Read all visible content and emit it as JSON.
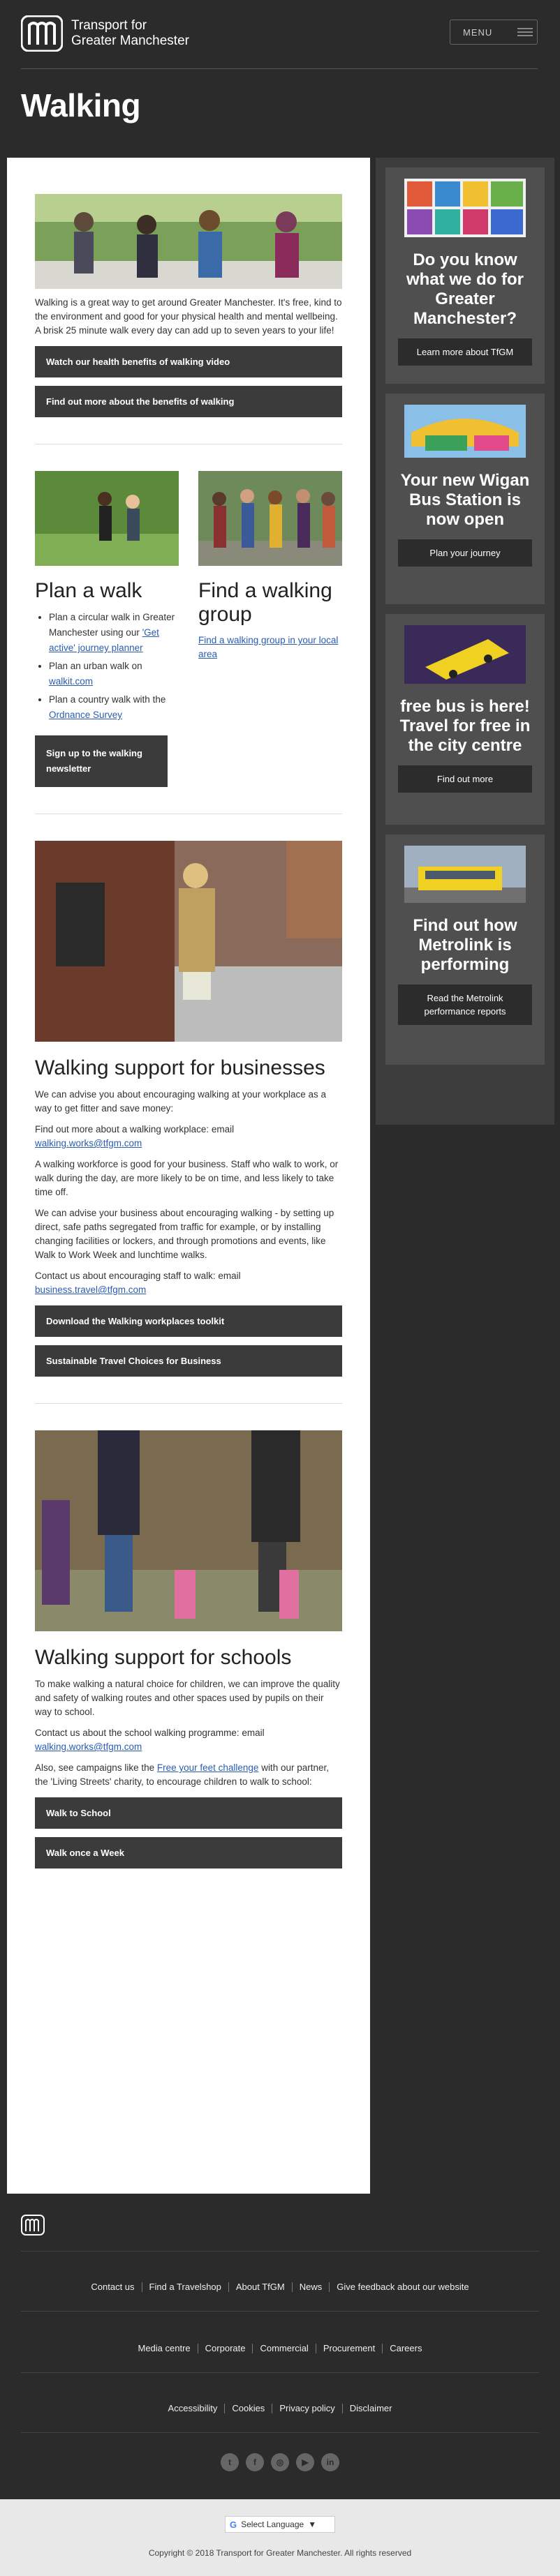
{
  "header": {
    "brand_line1": "Transport for",
    "brand_line2": "Greater Manchester",
    "menu_label": "MENU",
    "page_title": "Walking"
  },
  "intro": {
    "text": "Walking is a great way to get around Greater Manchester. It's free, kind to the environment and good for your physical health and mental wellbeing. A brisk 25 minute walk every day can add up to seven years to your life!",
    "btn_video": "Watch our health benefits of walking video",
    "btn_benefits": "Find out more about the benefits of walking"
  },
  "plan": {
    "title": "Plan a walk",
    "item1_pre": "Plan a circular walk in Greater Manchester using our ",
    "item1_link": "'Get active' journey planner",
    "item2_pre": "Plan an urban walk on ",
    "item2_link": "walkit.com",
    "item3_pre": "Plan a country walk with the ",
    "item3_link": "Ordnance Survey",
    "newsletter_btn": "Sign up to the walking newsletter"
  },
  "group": {
    "title": "Find a walking group",
    "link": "Find a walking group in your local area"
  },
  "business": {
    "title": "Walking support for businesses",
    "p1": "We can advise you about encouraging walking at your workplace as a way to get fitter and save money:",
    "p2_pre": "Find out more about a walking workplace: email ",
    "p2_link": "walking.works@tfgm.com",
    "p3": "A walking workforce is good for your business. Staff who walk to work, or walk during the day, are more likely to be on time, and less likely to take time off.",
    "p4": "We can advise your business about encouraging walking - by setting up direct, safe paths segregated from traffic for example, or by installing changing facilities or lockers, and through promotions and events, like Walk to Work Week and lunchtime walks.",
    "p5_pre": "Contact us about encouraging staff to walk: email ",
    "p5_link": "business.travel@tfgm.com",
    "btn_toolkit": "Download the Walking workplaces toolkit",
    "btn_sustainable": "Sustainable Travel Choices for Business"
  },
  "schools": {
    "title": "Walking support for schools",
    "p1": "To make walking a natural choice for children, we can improve the quality and safety of walking routes and other spaces used by pupils on their way to school.",
    "p2_pre": "Contact us about the school walking programme: email ",
    "p2_link": "walking.works@tfgm.com",
    "p3_pre": "Also, see campaigns like the ",
    "p3_link": "Free your feet challenge",
    "p3_post": " with our partner, the 'Living Streets' charity, to encourage children to walk to school:",
    "btn_walk_school": "Walk to School",
    "btn_walk_week": "Walk once a Week"
  },
  "sidebar": {
    "cards": [
      {
        "title": "Do you know what we do for Greater Manchester?",
        "button": "Learn more about TfGM"
      },
      {
        "title": "Your new Wigan Bus Station is now open",
        "button": "Plan your journey"
      },
      {
        "title": "free bus is here! Travel for free in the city centre",
        "button": "Find out more"
      },
      {
        "title": "Find out how Metrolink is performing",
        "button": "Read the Metrolink performance reports"
      }
    ]
  },
  "footer": {
    "row1": [
      "Contact us",
      "Find a Travelshop",
      "About TfGM",
      "News",
      "Give feedback about our website"
    ],
    "row2": [
      "Media centre",
      "Corporate",
      "Commercial",
      "Procurement",
      "Careers"
    ],
    "row3": [
      "Accessibility",
      "Cookies",
      "Privacy policy",
      "Disclaimer"
    ],
    "socials": [
      "twitter-icon",
      "facebook-icon",
      "instagram-icon",
      "youtube-icon",
      "linkedin-icon"
    ],
    "language_label": "Select Language",
    "copyright": "Copyright © 2018 Transport for Greater Manchester. All rights reserved"
  }
}
